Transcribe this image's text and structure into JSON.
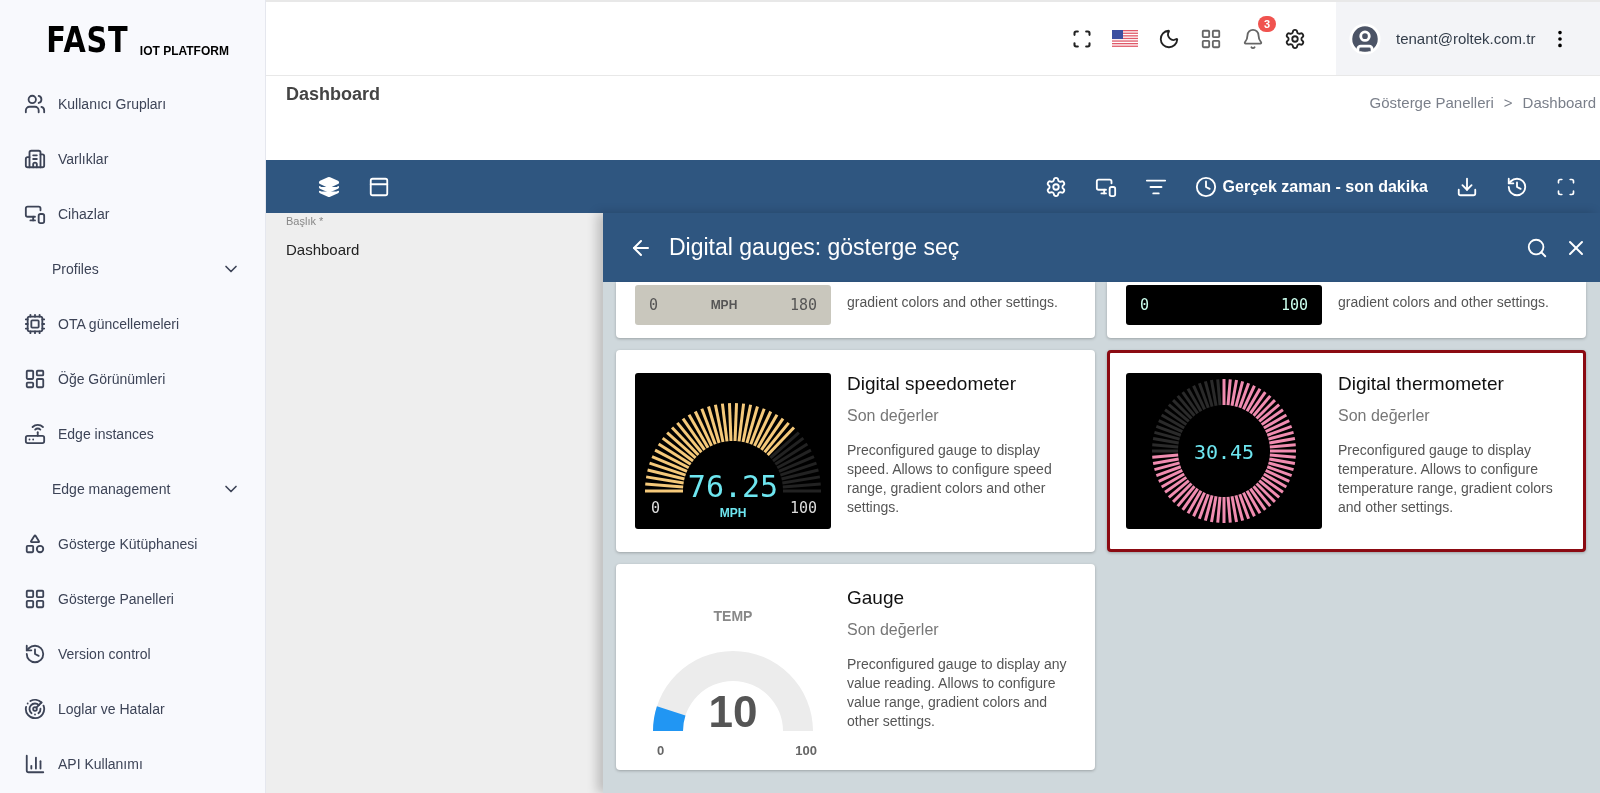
{
  "logo": {
    "main": "FAST",
    "sub": "IOT PLATFORM"
  },
  "sidebar": {
    "items": [
      {
        "kind": "link",
        "label": "Kullanıcı Grupları"
      },
      {
        "kind": "link",
        "label": "Varlıklar"
      },
      {
        "kind": "link",
        "label": "Cihazlar"
      },
      {
        "kind": "section",
        "label": "Profiles",
        "expanded": false
      },
      {
        "kind": "link",
        "label": "OTA güncellemeleri"
      },
      {
        "kind": "link",
        "label": "Öğe Görünümleri"
      },
      {
        "kind": "link",
        "label": "Edge instances"
      },
      {
        "kind": "section",
        "label": "Edge management",
        "expanded": false
      },
      {
        "kind": "link",
        "label": "Gösterge Kütüphanesi"
      },
      {
        "kind": "link",
        "label": "Gösterge Panelleri"
      },
      {
        "kind": "link",
        "label": "Version control"
      },
      {
        "kind": "link",
        "label": "Loglar ve Hatalar"
      },
      {
        "kind": "link",
        "label": "API Kullanımı"
      }
    ]
  },
  "topbar": {
    "notification_count": "3",
    "user": "tenant@roltek.com.tr"
  },
  "page": {
    "title": "Dashboard",
    "breadcrumb": [
      "Gösterge Panelleri",
      "Dashboard"
    ],
    "breadcrumb_separator": ">"
  },
  "toolbar": {
    "timewindow": "Gerçek zaman - son dakika"
  },
  "settings_panel": {
    "field_label": "Başlık *",
    "field_value": "Dashboard"
  },
  "widget_picker": {
    "title": "Digital gauges: gösterge seç",
    "cards": [
      {
        "kind": "partial-light",
        "selected": false,
        "preview_texts": [
          "0",
          "MPH",
          "180"
        ],
        "description": "gradient colors and other settings."
      },
      {
        "kind": "partial-dark",
        "selected": false,
        "preview_texts": [
          "0",
          "100"
        ],
        "description": "gradient colors and other settings."
      },
      {
        "kind": "speedometer",
        "selected": false,
        "title": "Digital speedometer",
        "subtitle": "Son değerler",
        "preview_texts": [
          "76.25",
          "0",
          "MPH",
          "100"
        ],
        "description": "Preconfigured gauge to display speed. Allows to configure speed range, gradient colors and other settings."
      },
      {
        "kind": "thermometer",
        "selected": true,
        "title": "Digital thermometer",
        "subtitle": "Son değerler",
        "preview_texts": [
          "30.45"
        ],
        "description": "Preconfigured gauge to display temperature. Allows to configure temperature range, gradient colors and other settings."
      },
      {
        "kind": "gauge",
        "selected": false,
        "title": "Gauge",
        "subtitle": "Son değerler",
        "level": 0.1,
        "preview_texts": [
          "TEMP",
          "10",
          "0",
          "100"
        ],
        "description": "Preconfigured gauge to display any value reading. Allows to configure value range, gradient colors and other settings."
      }
    ]
  }
}
